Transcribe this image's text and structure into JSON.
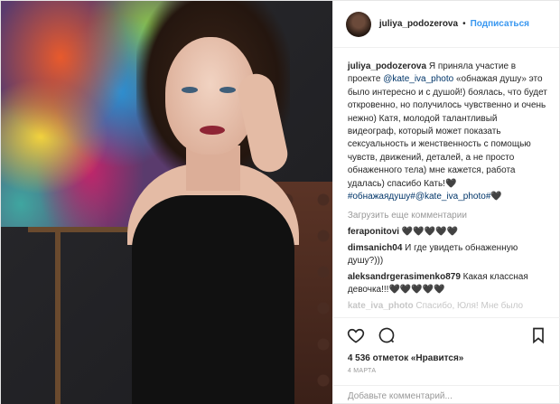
{
  "header": {
    "username": "juliya_podozerova",
    "separator": "•",
    "follow_label": "Подписаться"
  },
  "caption": {
    "username": "juliya_podozerova",
    "text_1": " Я приняла участие в проекте ",
    "mention": "@kate_iva_photo",
    "text_2": " «обнажая душу» это было интересно и с душой!) боялась, что будет откровенно, но получилось чувственно и очень нежно) Катя, молодой талантливый видеограф, который может показать сексуальность и женственность с помощью чувств, движений, деталей, а не просто обнаженного тела) мне кажется, работа удалась) спасибо Кать!",
    "hashtag": "#обнажаядушу",
    "mention_2": "#@kate_iva_photo#",
    "emoji_a": "🖤",
    "emoji_b": "🖤"
  },
  "load_more_label": "Загрузить еще комментарии",
  "comments": [
    {
      "username": "feraponitovi",
      "text": " 🖤🖤🖤🖤🖤"
    },
    {
      "username": "dimsanich04",
      "text": " И где увидеть обнаженную душу?)))"
    },
    {
      "username": "aleksandrgerasimenko879",
      "text": " Какая классная девочка!!!🖤🖤🖤🖤🖤"
    },
    {
      "username": "kate_iva_photo",
      "text": " Спасибо, Юля! Мне было"
    }
  ],
  "actions": {
    "like_icon": "heart-icon",
    "comment_icon": "comment-icon",
    "save_icon": "bookmark-icon"
  },
  "likes": {
    "count": "4 536",
    "text": " отметок «Нравится»"
  },
  "date": "4 МАРТА",
  "add_comment": {
    "placeholder": "Добавьте комментарий..."
  }
}
